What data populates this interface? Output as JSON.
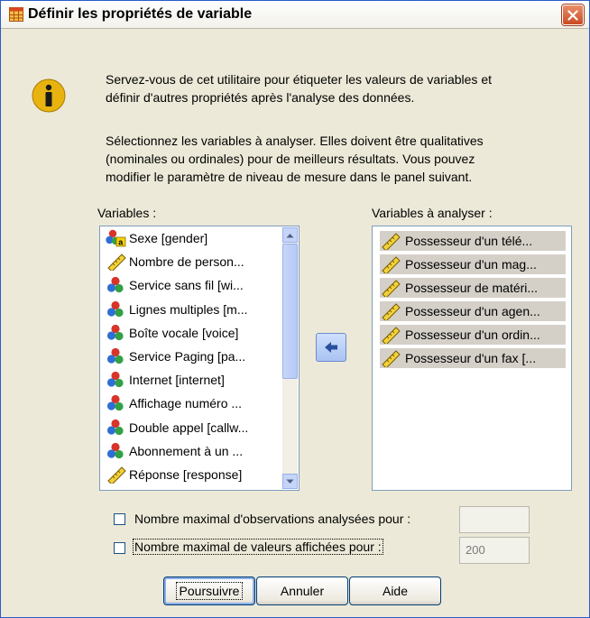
{
  "window": {
    "title": "Définir les propriétés de variable"
  },
  "intro": {
    "paragraph1_line1": "Servez-vous de cet utilitaire pour étiqueter les valeurs de variables et",
    "paragraph1_line2": "définir d'autres propriétés après l'analyse des données.",
    "paragraph2_line1": "Sélectionnez les variables à analyser. Elles doivent être qualitatives",
    "paragraph2_line2": "(nominales ou ordinales) pour de meilleurs résultats. Vous pouvez",
    "paragraph2_line3": "modifier le paramètre de niveau de mesure dans le panel suivant."
  },
  "variables_list": {
    "label": "Variables :",
    "items": [
      {
        "label": "Sexe [gender]",
        "icon": "nominal-string-icon"
      },
      {
        "label": "Nombre de person...",
        "icon": "scale-ruler-icon"
      },
      {
        "label": "Service sans fil [wi...",
        "icon": "nominal-icon"
      },
      {
        "label": "Lignes multiples [m...",
        "icon": "nominal-icon"
      },
      {
        "label": "Boîte vocale [voice]",
        "icon": "nominal-icon"
      },
      {
        "label": "Service Paging [pa...",
        "icon": "nominal-icon"
      },
      {
        "label": "Internet [internet]",
        "icon": "nominal-icon"
      },
      {
        "label": "Affichage numéro ...",
        "icon": "nominal-icon"
      },
      {
        "label": "Double appel [callw...",
        "icon": "nominal-icon"
      },
      {
        "label": "Abonnement à un ...",
        "icon": "nominal-icon"
      },
      {
        "label": "Réponse [response]",
        "icon": "scale-ruler-icon"
      }
    ]
  },
  "analyze_list": {
    "label": "Variables à analyser :",
    "items": [
      {
        "label": "Possesseur  d'un télé...",
        "icon": "scale-ruler-icon"
      },
      {
        "label": "Possesseur d'un mag...",
        "icon": "scale-ruler-icon"
      },
      {
        "label": "Possesseur de matéri...",
        "icon": "scale-ruler-icon"
      },
      {
        "label": "Possesseur d'un agen...",
        "icon": "scale-ruler-icon"
      },
      {
        "label": "Possesseur d'un ordin...",
        "icon": "scale-ruler-icon"
      },
      {
        "label": "Possesseur d'un fax [...",
        "icon": "scale-ruler-icon"
      }
    ]
  },
  "move_button_icon": "arrow-left-icon",
  "options": {
    "max_cases_label": "Nombre maximal d'observations analysées pour :",
    "max_cases_value": "",
    "max_values_label": "Nombre maximal de valeurs affichées pour :",
    "max_values_value": "200"
  },
  "buttons": {
    "continue": "Poursuivre",
    "cancel": "Annuler",
    "help": "Aide"
  },
  "colors": {
    "dialog_bg": "#ece9d8",
    "selection_bg": "#d4d0c8",
    "close_button": "#c94b23"
  }
}
